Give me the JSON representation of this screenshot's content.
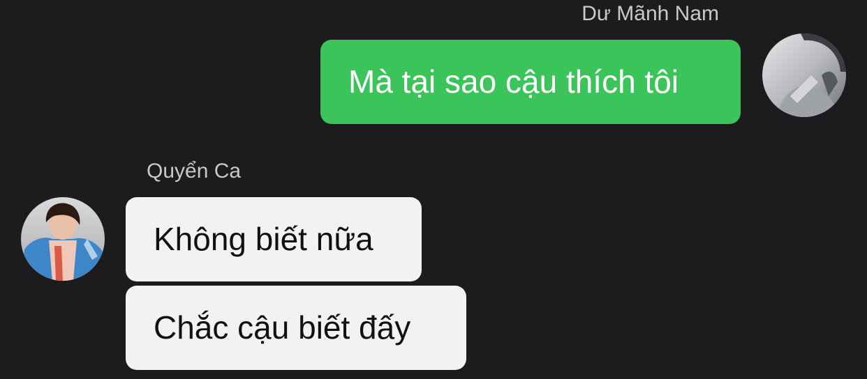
{
  "messages": [
    {
      "sender": "Dư Mãnh Nam",
      "direction": "outgoing",
      "avatar_icon": "avatar-icon",
      "bubbles": [
        "Mà tại sao cậu thích tôi"
      ]
    },
    {
      "sender": "Quyển Ca",
      "direction": "incoming",
      "avatar_icon": "avatar-icon",
      "bubbles": [
        "Không biết nữa",
        "Chắc cậu biết đấy"
      ]
    }
  ],
  "colors": {
    "background": "#1c1c1e",
    "outgoing_bubble": "#3ac45a",
    "incoming_bubble": "#f2f2f3",
    "sender_name": "#c9c9cc"
  }
}
